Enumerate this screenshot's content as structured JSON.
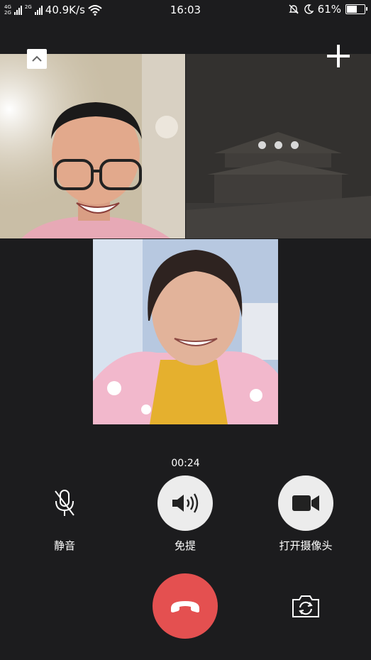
{
  "status_bar": {
    "network_tag_top": "4G",
    "network_tag_bottom": "2G",
    "network_tag_second": "2G",
    "speed": "40.9K/s",
    "time": "16:03",
    "battery_percent": "61%",
    "battery_level": 0.61
  },
  "call": {
    "duration": "00:24"
  },
  "controls": {
    "mute_label": "静音",
    "speaker_label": "免提",
    "camera_label": "打开摄像头"
  },
  "icons": {
    "collapse": "chevron-up-icon",
    "add": "plus-icon",
    "mute": "microphone-off-icon",
    "speaker": "speaker-icon",
    "camera": "video-camera-icon",
    "hangup": "phone-hangup-icon",
    "switch_camera": "camera-switch-icon"
  },
  "colors": {
    "background": "#1c1c1e",
    "hangup": "#e45050",
    "control_circle": "#ececec"
  }
}
